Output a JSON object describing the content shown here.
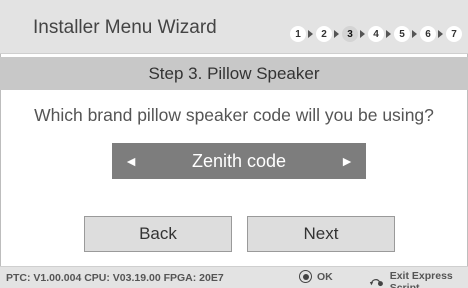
{
  "header": {
    "title": "Installer Menu Wizard",
    "steps": [
      "1",
      "2",
      "3",
      "4",
      "5",
      "6",
      "7"
    ],
    "active_step": "3"
  },
  "step_header": {
    "label": "Step 3. Pillow Speaker"
  },
  "question": {
    "text": "Which brand pillow speaker code will you be using?"
  },
  "selector": {
    "left_arrow": "◄",
    "value": "Zenith code",
    "right_arrow": "►"
  },
  "buttons": {
    "back_label": "Back",
    "next_label": "Next"
  },
  "footer": {
    "info": "PTC: V1.00.004 CPU: V03.19.00 FPGA: 20E7",
    "ok_label": "OK",
    "exit_label": "Exit Express Script"
  },
  "colors": {
    "title_bar": "#e3e3e3",
    "step_header": "#c8c8c8",
    "selector_bg": "#7d7d7d",
    "button_bg": "#dddddd"
  }
}
